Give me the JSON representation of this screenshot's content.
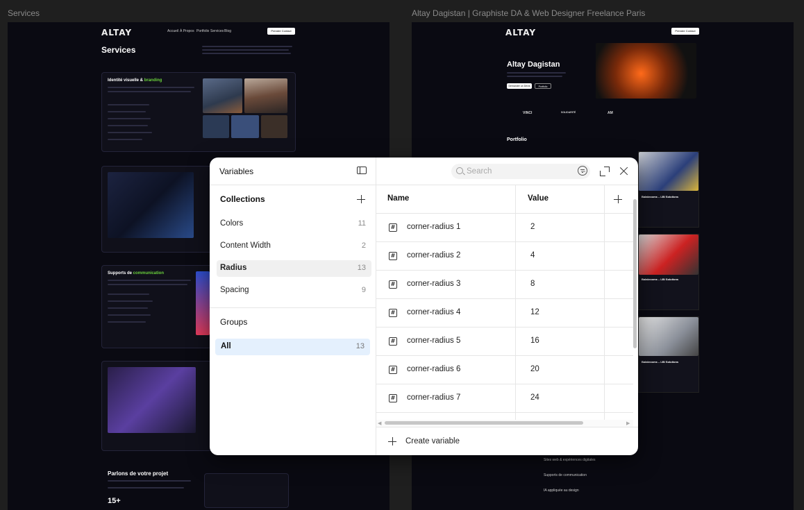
{
  "canvas": {
    "left_frame_label": "Services",
    "right_frame_label": "Altay Dagistan | Graphiste DA & Web Designer Freelance Paris"
  },
  "left_frame": {
    "logo": "ALTAY",
    "nav": [
      "Accueil",
      "À Propos",
      "Portfolio",
      "Services",
      "Blog"
    ],
    "cta": "Prendre Contact",
    "page_title": "Services",
    "card1_title_a": "Identité visuelle & ",
    "card1_title_b": "branding",
    "card3_title_a": "Supports de ",
    "card3_title_b": "communication",
    "contact_title": "Parlons de votre projet",
    "stat": "15+"
  },
  "right_frame": {
    "logo": "ALTAY",
    "hero_title": "Altay Dagistan",
    "btn_primary": "Demander un Devis",
    "btn_secondary": "Portfolio",
    "brands": [
      "VINCI",
      "SOLIDARITÉ",
      "AM",
      "",
      ""
    ],
    "portfolio_title": "Portfolio",
    "cards": [
      "Balakrooms – LBI Solutions",
      "Balakrooms – LBI Solutions",
      "Balakrooms – LBI Solutions"
    ],
    "services": [
      "Sites web & expériences digitales",
      "Supports de communication",
      "IA appliquée au design"
    ]
  },
  "modal": {
    "sidebar_title": "Variables",
    "collections_title": "Collections",
    "collections": [
      {
        "label": "Colors",
        "count": "11"
      },
      {
        "label": "Content Width",
        "count": "2"
      },
      {
        "label": "Radius",
        "count": "13"
      },
      {
        "label": "Spacing",
        "count": "9"
      }
    ],
    "groups_title": "Groups",
    "groups": [
      {
        "label": "All",
        "count": "13"
      }
    ],
    "search_placeholder": "Search",
    "columns": {
      "name": "Name",
      "value": "Value"
    },
    "rows": [
      {
        "name": "corner-radius 1",
        "value": "2"
      },
      {
        "name": "corner-radius 2",
        "value": "4"
      },
      {
        "name": "corner-radius 3",
        "value": "8"
      },
      {
        "name": "corner-radius 4",
        "value": "12"
      },
      {
        "name": "corner-radius 5",
        "value": "16"
      },
      {
        "name": "corner-radius 6",
        "value": "20"
      },
      {
        "name": "corner-radius 7",
        "value": "24"
      }
    ],
    "create_label": "Create variable"
  }
}
